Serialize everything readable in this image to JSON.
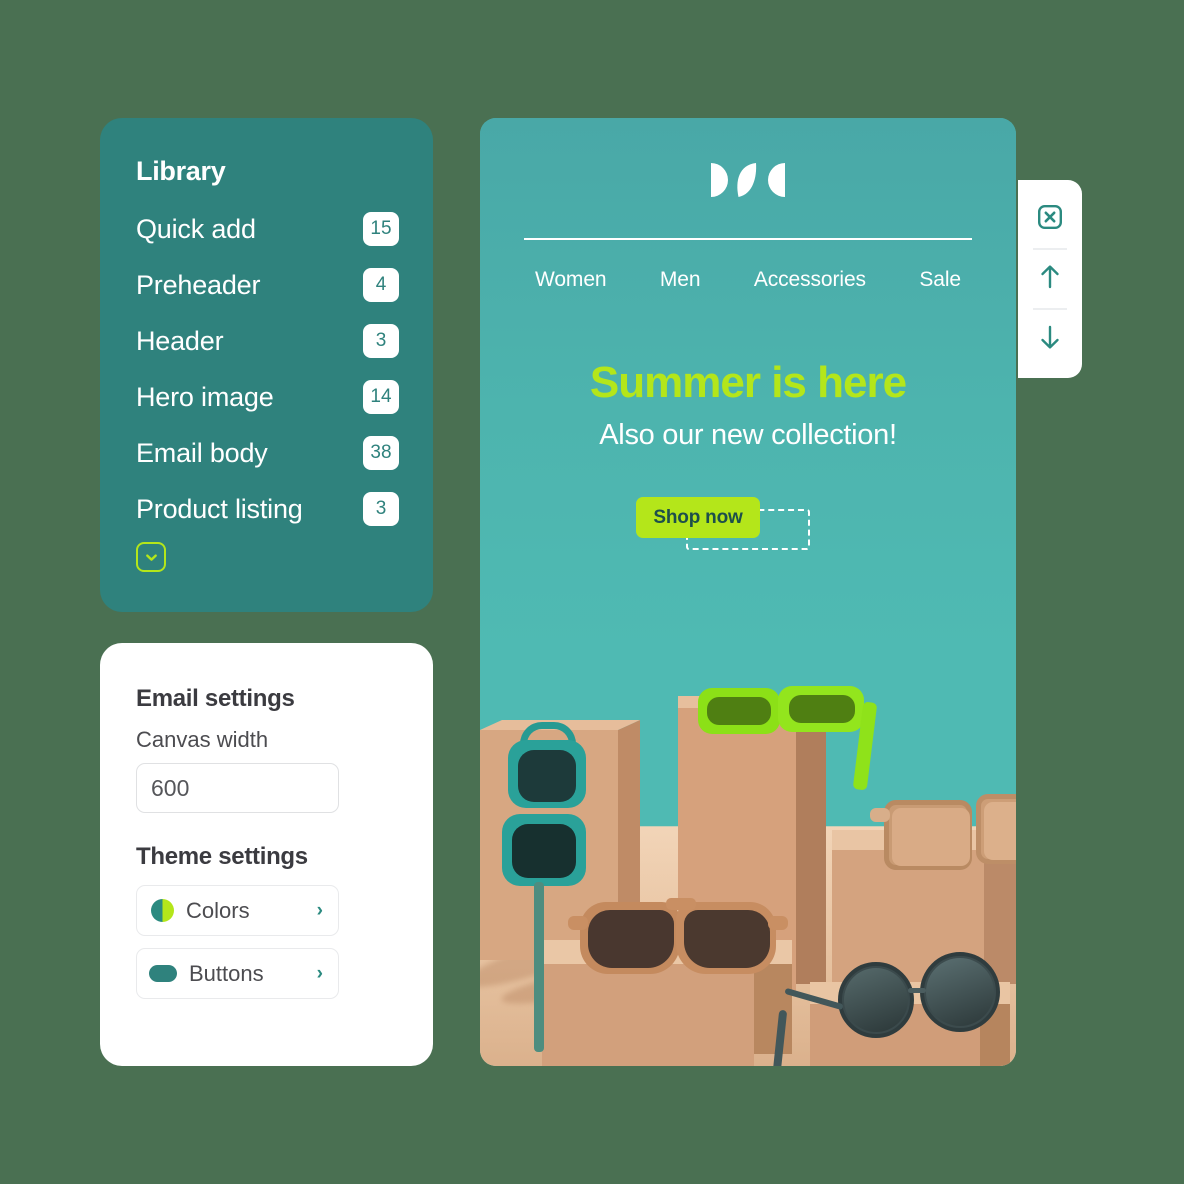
{
  "canvas": {
    "background_color": "#4a7052"
  },
  "library": {
    "title": "Library",
    "accent_color": "#2f827d",
    "items": [
      {
        "label": "Quick add",
        "count": "15"
      },
      {
        "label": "Preheader",
        "count": "4"
      },
      {
        "label": "Header",
        "count": "3"
      },
      {
        "label": "Hero image",
        "count": "14"
      },
      {
        "label": "Email body",
        "count": "38"
      },
      {
        "label": "Product listing",
        "count": "3"
      }
    ],
    "expand_icon": "chevron-down-icon"
  },
  "settings": {
    "email_settings_title": "Email settings",
    "canvas_width_label": "Canvas width",
    "canvas_width_value": "600",
    "canvas_width_placeholder": "600",
    "theme_settings_title": "Theme settings",
    "rows": [
      {
        "label": "Colors",
        "icon": "color-swatch-icon",
        "chevron": "›"
      },
      {
        "label": "Buttons",
        "icon": "button-pill-icon",
        "chevron": "›"
      }
    ]
  },
  "email": {
    "logo_alt": "brand-logo",
    "nav": [
      {
        "label": "Women"
      },
      {
        "label": "Men"
      },
      {
        "label": "Accessories"
      },
      {
        "label": "Sale"
      }
    ],
    "hero_title": "Summer is here",
    "hero_subtitle": "Also our new collection!",
    "cta_label": "Shop now",
    "accent_color": "#b4e61a",
    "background_color": "#4ab1ac"
  },
  "toolbar": {
    "buttons": [
      {
        "name": "delete-block-button",
        "icon": "close-box-icon"
      },
      {
        "name": "move-up-button",
        "icon": "arrow-up-icon"
      },
      {
        "name": "move-down-button",
        "icon": "arrow-down-icon"
      }
    ]
  }
}
